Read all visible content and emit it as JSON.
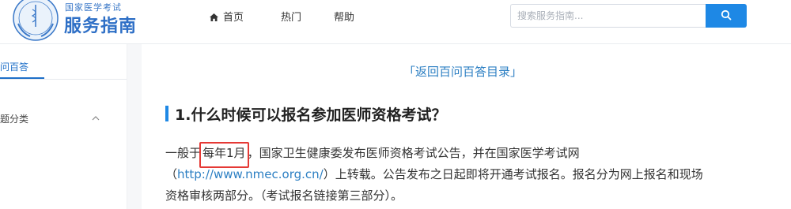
{
  "header": {
    "logo_subtitle": "国家医学考试",
    "logo_title": "服务指南",
    "nav": {
      "home_label": "首页",
      "hot_label": "热门",
      "help_label": "帮助"
    },
    "search": {
      "placeholder": "搜索服务指南..."
    },
    "colors": {
      "brand": "#2e6fc6",
      "search_button": "#1e88e5"
    }
  },
  "sidebar": {
    "tab_label": "百问百答",
    "category_label": "问题分类"
  },
  "main": {
    "back_link": "「返回百问百答目录」",
    "question_title": "1.什么时候可以报名参加医师资格考试？",
    "answer": {
      "line1_prefix": "一般于",
      "line1_highlight": "每年1月",
      "line1_suffix": "，国家卫生健康委发布医师资格考试公告，并在国家医学考试网",
      "line2_open": "（",
      "line2_url": "http://www.nmec.org.cn/",
      "line2_rest": "）上转载。公告发布之日起即将开通考试报名。报名分为网上报名和现场",
      "line3": "资格审核两部分。（考试报名链接第三部分）。"
    },
    "colors": {
      "highlight_border": "#e53935",
      "link": "#2c7fc3",
      "title_bar": "#1e88e5"
    }
  }
}
